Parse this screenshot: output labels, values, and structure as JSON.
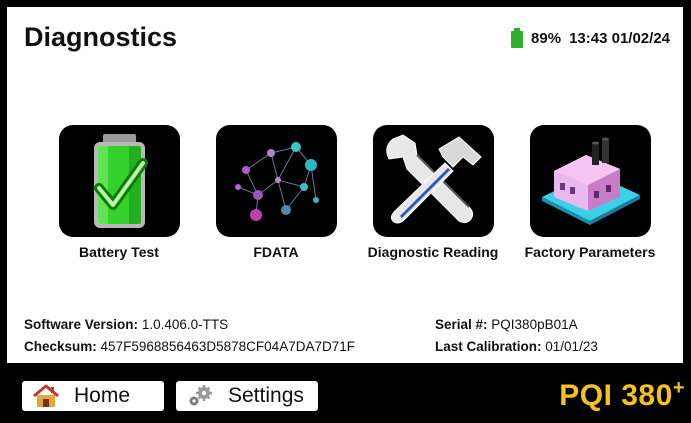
{
  "header": {
    "title": "Diagnostics",
    "battery_percent": "89%",
    "datetime": "13:43 01/02/24",
    "battery_color": "#2fae2f"
  },
  "tiles": [
    {
      "label": "Battery Test",
      "icon": "battery-check-icon"
    },
    {
      "label": "FDATA",
      "icon": "network-graph-icon"
    },
    {
      "label": "Diagnostic Reading",
      "icon": "wrench-hammer-icon"
    },
    {
      "label": "Factory Parameters",
      "icon": "factory-icon"
    }
  ],
  "info": {
    "software_version_label": "Software Version:",
    "software_version_value": "1.0.406.0-TTS",
    "checksum_label": "Checksum:",
    "checksum_value": "457F5968856463D5878CF04A7DA7D71F",
    "serial_label": "Serial #:",
    "serial_value": "PQI380pB01A",
    "calibration_label": "Last Calibration:",
    "calibration_value": "01/01/23"
  },
  "footer": {
    "home_label": "Home",
    "settings_label": "Settings",
    "brand": "PQI 380",
    "brand_sup": "+",
    "brand_color": "#f6c21a"
  }
}
